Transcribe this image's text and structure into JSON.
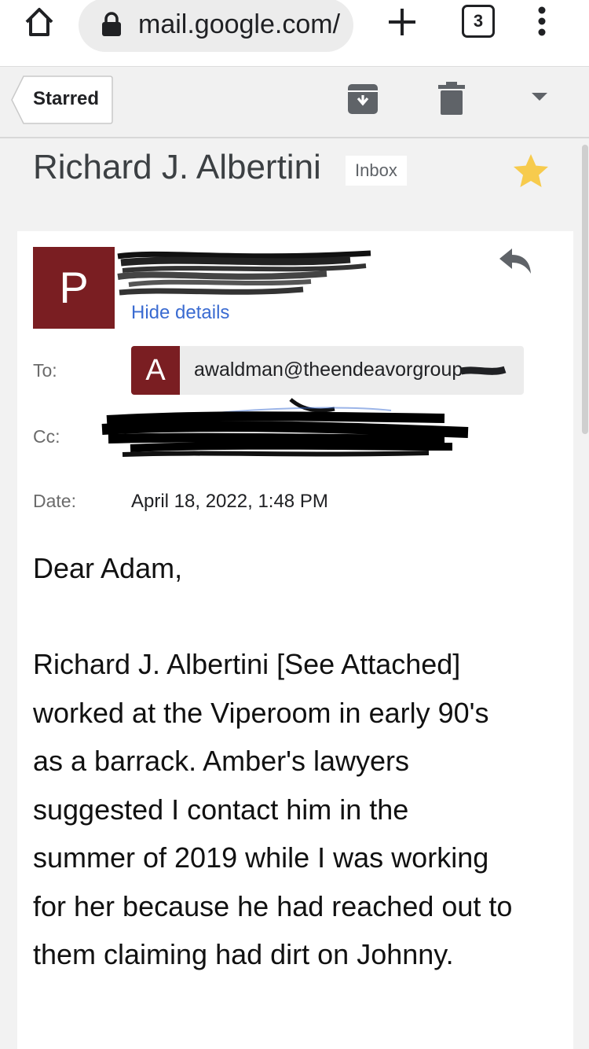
{
  "browser": {
    "url": "mail.google.com/",
    "tab_count": "3",
    "icons": [
      "home-icon",
      "lock-icon",
      "plus-icon",
      "tabs-icon",
      "kebab-menu-icon"
    ]
  },
  "toolbar": {
    "back_label": "Starred",
    "icons": [
      "archive-icon",
      "trash-icon",
      "dropdown-arrow-icon"
    ]
  },
  "email": {
    "subject": "Richard J. Albertini",
    "label": "Inbox",
    "starred": true,
    "sender_initial": "P",
    "hide_details": "Hide details",
    "to_label": "To:",
    "to_initial": "A",
    "to_address": "awaldman@theendeavorgroup",
    "cc_label": "Cc:",
    "date_label": "Date:",
    "date_value": "April 18, 2022, 1:48 PM",
    "greeting": "Dear Adam,",
    "body_lines": [
      "Richard J. Albertini [See Attached]",
      "worked at the Viperoom in early 90's",
      "as a barrack.  Amber's lawyers",
      "suggested I contact him in the",
      "summer of 2019 while I was working",
      "for her because he had reached out to",
      "them claiming had dirt on Johnny."
    ]
  },
  "colors": {
    "avatar": "#7a1e22",
    "link": "#3a6bd1",
    "star": "#f7cb4d"
  }
}
